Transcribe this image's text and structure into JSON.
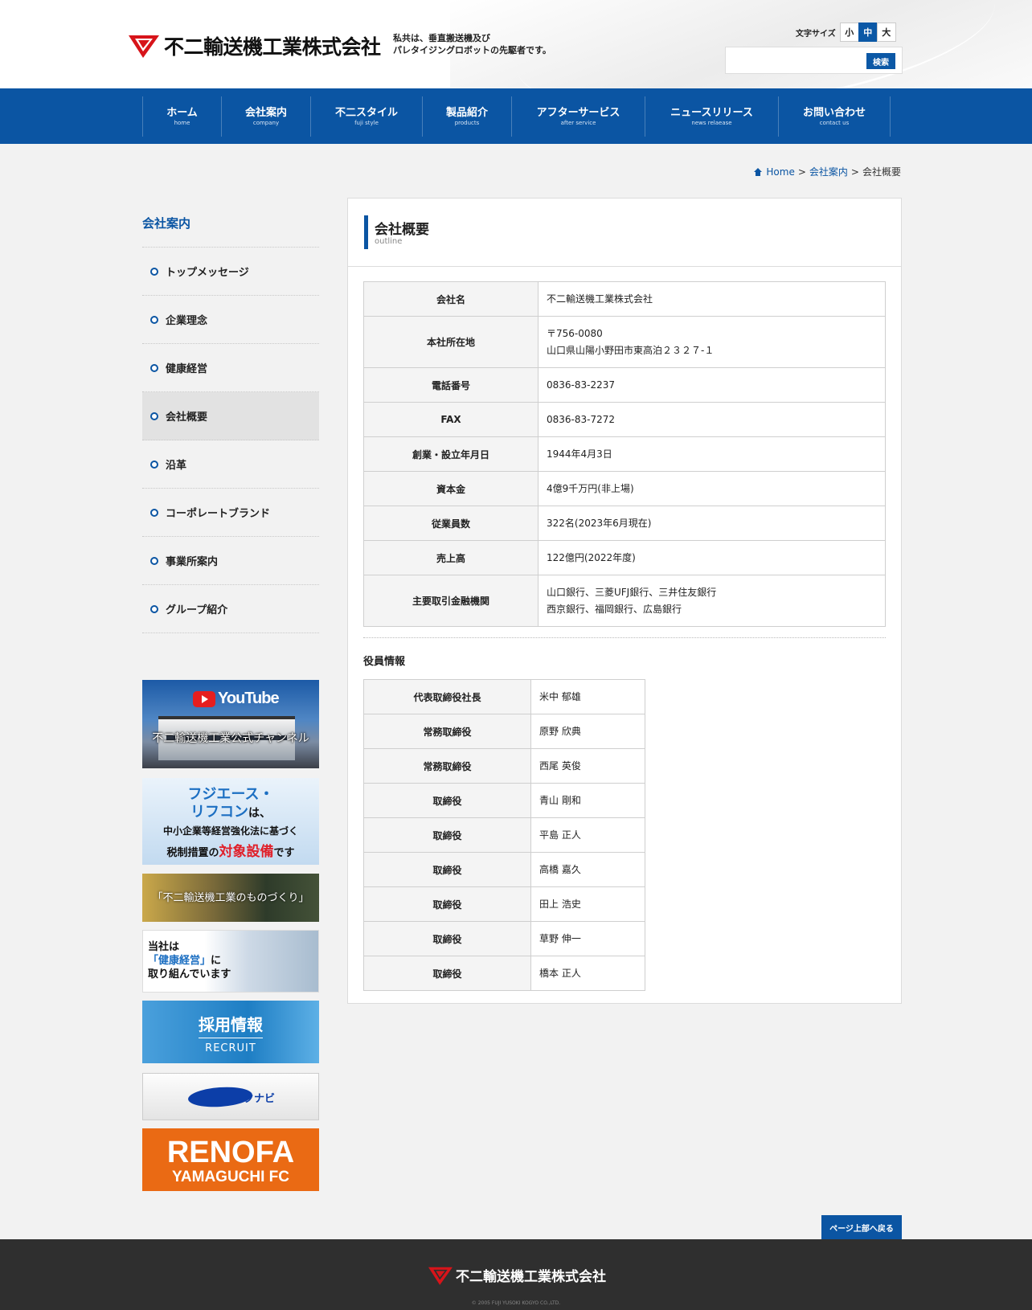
{
  "header": {
    "company_name": "不二輸送機工業株式会社",
    "tagline_1": "私共は、垂直搬送機及び",
    "tagline_2": "パレタイジングロボットの先駆者です。",
    "font_size_label": "文字サイズ",
    "font_sizes": [
      "小",
      "中",
      "大"
    ],
    "search_button": "検索",
    "search_value": ""
  },
  "nav": [
    {
      "jp": "ホーム",
      "en": "home"
    },
    {
      "jp": "会社案内",
      "en": "company"
    },
    {
      "jp": "不二スタイル",
      "en": "fuji style"
    },
    {
      "jp": "製品紹介",
      "en": "products"
    },
    {
      "jp": "アフターサービス",
      "en": "after service"
    },
    {
      "jp": "ニュースリリース",
      "en": "news relaease"
    },
    {
      "jp": "お問い合わせ",
      "en": "contact us"
    }
  ],
  "breadcrumb": {
    "home": "Home",
    "company": "会社案内",
    "current": "会社概要",
    "sep": ">"
  },
  "sidebar": {
    "title": "会社案内",
    "items": [
      "トップメッセージ",
      "企業理念",
      "健康経営",
      "会社概要",
      "沿革",
      "コーポレートブランド",
      "事業所案内",
      "グループ紹介"
    ],
    "active_index": 3
  },
  "banners": {
    "youtube": {
      "logo": "YouTube",
      "caption": "不二輸送機工業公式チャンネル"
    },
    "fujiace": {
      "line1": "フジエース・",
      "line2a": "リフコン",
      "line2b": "は、",
      "line3": "中小企業等経営強化法に基づく",
      "line4a": "税制措置の",
      "line4b": "対象設備",
      "line4c": "です"
    },
    "monozukuri": {
      "caption": "「不二輸送機工業のものづくり」"
    },
    "kenko": {
      "line1": "当社は",
      "line2": "「健康経営」",
      "line2b": "に",
      "line3": "取り組んでいます"
    },
    "recruit": {
      "title": "採用情報",
      "sub": "RECRUIT"
    },
    "rikunabi": {
      "text": "リクナビ"
    },
    "renofa": {
      "title": "RENOFA",
      "sub": "YAMAGUCHI FC"
    }
  },
  "main": {
    "title": "会社概要",
    "subtitle": "outline",
    "outline": [
      {
        "label": "会社名",
        "value": "不二輸送機工業株式会社",
        "value2": ""
      },
      {
        "label": "本社所在地",
        "value": "〒756-0080",
        "value2": "山口県山陽小野田市東高泊２３２７-１"
      },
      {
        "label": "電話番号",
        "value": "0836-83-2237",
        "value2": ""
      },
      {
        "label": "FAX",
        "value": "0836-83-7272",
        "value2": ""
      },
      {
        "label": "創業・設立年月日",
        "value": "1944年4月3日",
        "value2": ""
      },
      {
        "label": "資本金",
        "value": "4億9千万円(非上場)",
        "value2": ""
      },
      {
        "label": "従業員数",
        "value": "322名(2023年6月現在)",
        "value2": ""
      },
      {
        "label": "売上高",
        "value": "122億円(2022年度)",
        "value2": ""
      },
      {
        "label": "主要取引金融機関",
        "value": "山口銀行、三菱UFJ銀行、三井住友銀行",
        "value2": "西京銀行、福岡銀行、広島銀行"
      }
    ],
    "officers_title": "役員情報",
    "officers": [
      {
        "role": "代表取締役社長",
        "name": "米中 郁雄"
      },
      {
        "role": "常務取締役",
        "name": "原野 欣典"
      },
      {
        "role": "常務取締役",
        "name": "西尾 英俊"
      },
      {
        "role": "取締役",
        "name": "青山 剛和"
      },
      {
        "role": "取締役",
        "name": "平島 正人"
      },
      {
        "role": "取締役",
        "name": "高橋 嘉久"
      },
      {
        "role": "取締役",
        "name": "田上 浩史"
      },
      {
        "role": "取締役",
        "name": "草野 伸一"
      },
      {
        "role": "取締役",
        "name": "橋本 正人"
      }
    ]
  },
  "page_top": "ページ上部へ戻る",
  "footer": {
    "company_name": "不二輸送機工業株式会社",
    "copyright": "© 2005 FUJI YUSOKI KOGYO CO.,LTD."
  },
  "colors": {
    "brand_blue": "#0b55a3",
    "logo_red": "#d7141a"
  }
}
